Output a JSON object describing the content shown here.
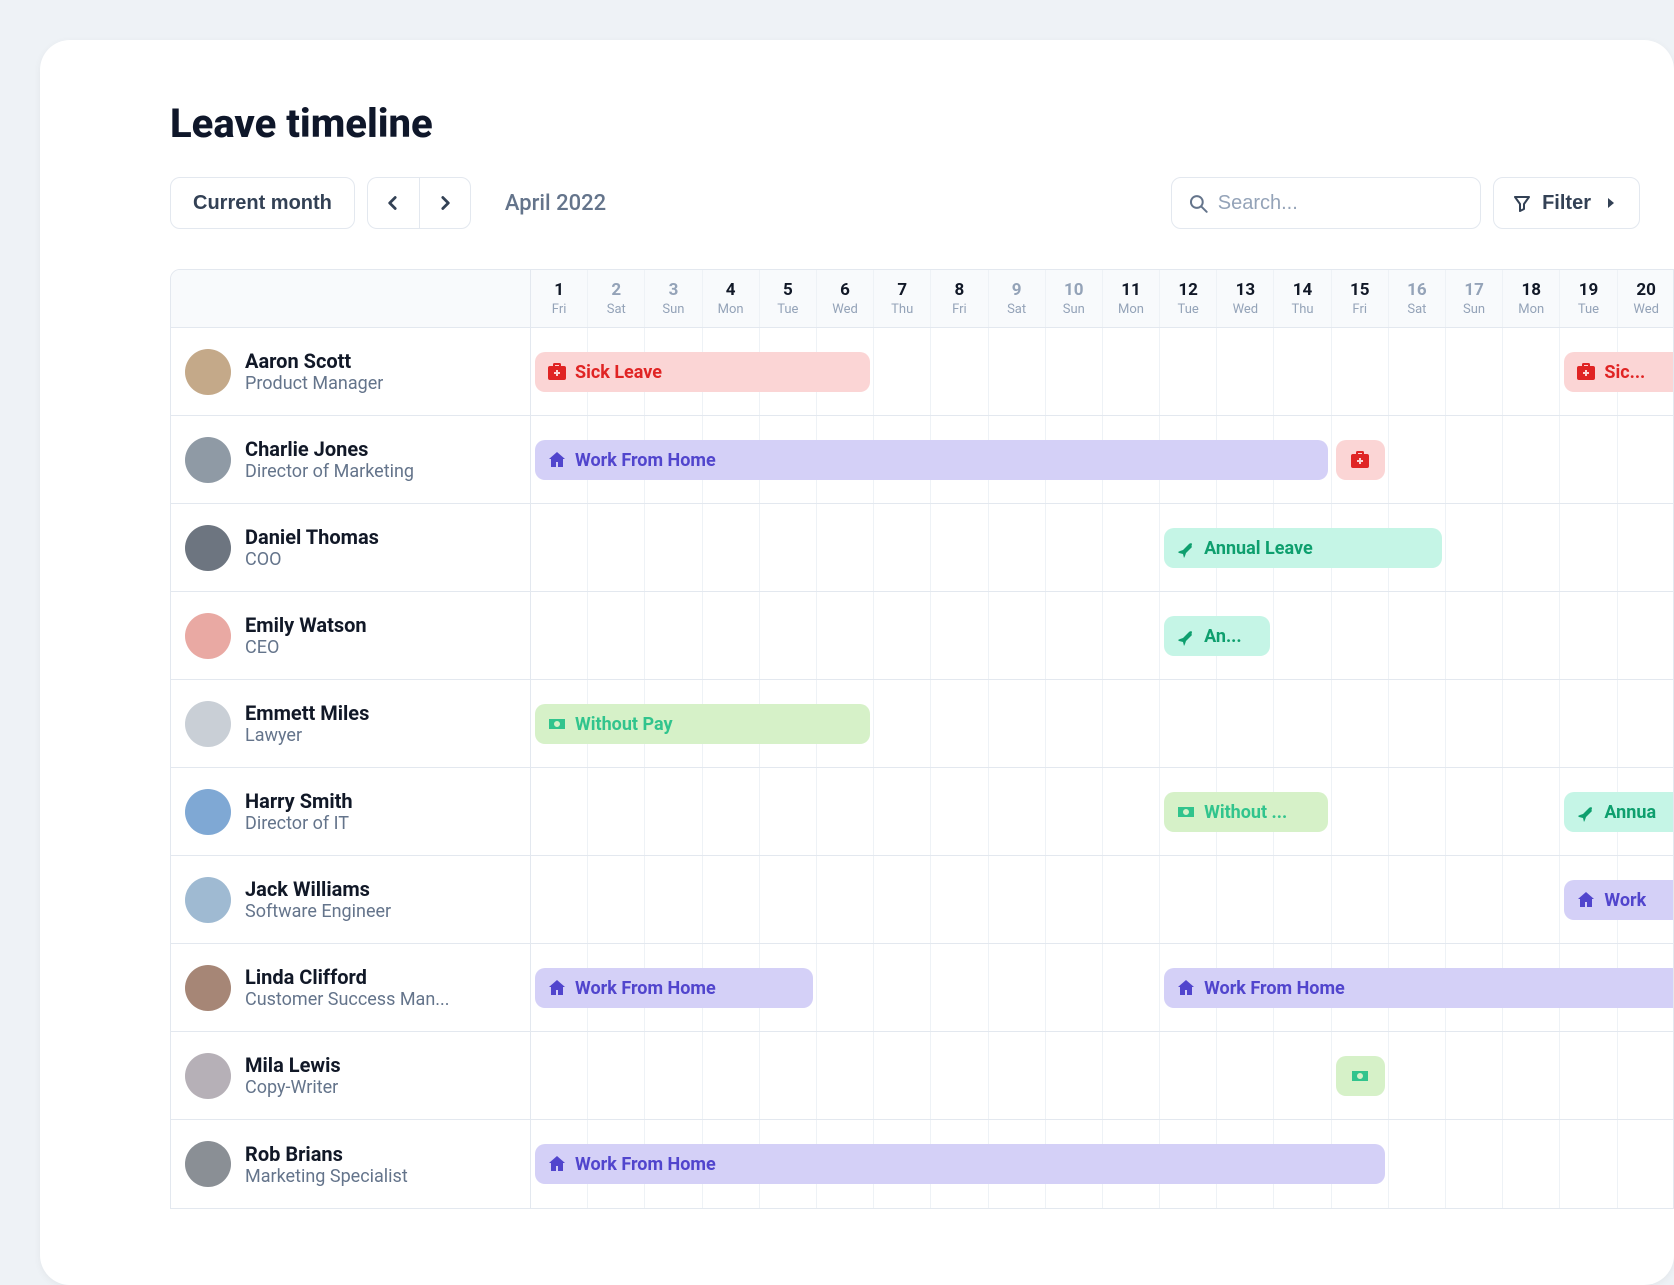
{
  "title": "Leave timeline",
  "toolbar": {
    "range_label": "Current month",
    "month": "April 2022",
    "search_placeholder": "Search...",
    "filter_label": "Filter"
  },
  "days": [
    {
      "num": "1",
      "dow": "Fri",
      "emph": true
    },
    {
      "num": "2",
      "dow": "Sat",
      "emph": false
    },
    {
      "num": "3",
      "dow": "Sun",
      "emph": false
    },
    {
      "num": "4",
      "dow": "Mon",
      "emph": true
    },
    {
      "num": "5",
      "dow": "Tue",
      "emph": true
    },
    {
      "num": "6",
      "dow": "Wed",
      "emph": true
    },
    {
      "num": "7",
      "dow": "Thu",
      "emph": true
    },
    {
      "num": "8",
      "dow": "Fri",
      "emph": true
    },
    {
      "num": "9",
      "dow": "Sat",
      "emph": false
    },
    {
      "num": "10",
      "dow": "Sun",
      "emph": false
    },
    {
      "num": "11",
      "dow": "Mon",
      "emph": true
    },
    {
      "num": "12",
      "dow": "Tue",
      "emph": true
    },
    {
      "num": "13",
      "dow": "Wed",
      "emph": true
    },
    {
      "num": "14",
      "dow": "Thu",
      "emph": true
    },
    {
      "num": "15",
      "dow": "Fri",
      "emph": true
    },
    {
      "num": "16",
      "dow": "Sat",
      "emph": false
    },
    {
      "num": "17",
      "dow": "Sun",
      "emph": false
    },
    {
      "num": "18",
      "dow": "Mon",
      "emph": true
    },
    {
      "num": "19",
      "dow": "Tue",
      "emph": true
    },
    {
      "num": "20",
      "dow": "Wed",
      "emph": true
    }
  ],
  "employees": [
    {
      "name": "Aaron Scott",
      "role": "Product Manager",
      "avatar": "#c4a989",
      "bars": [
        {
          "type": "sick",
          "icon": "medkit",
          "label": "Sick Leave",
          "start": 1,
          "span": 6
        },
        {
          "type": "sick",
          "icon": "medkit",
          "label": "Sic...",
          "start": 19,
          "span": 2,
          "clip_right": true
        }
      ]
    },
    {
      "name": "Charlie Jones",
      "role": "Director of Marketing",
      "avatar": "#8f9aa5",
      "bars": [
        {
          "type": "wfh",
          "icon": "home",
          "label": "Work From Home",
          "start": 1,
          "span": 14
        },
        {
          "type": "sick",
          "icon": "medkit",
          "label": "",
          "start": 15,
          "span": 1,
          "icon_only": true
        }
      ]
    },
    {
      "name": "Daniel Thomas",
      "role": "COO",
      "avatar": "#6d7580",
      "bars": [
        {
          "type": "annual",
          "icon": "plane",
          "label": "Annual Leave",
          "start": 12,
          "span": 5
        }
      ]
    },
    {
      "name": "Emily Watson",
      "role": "CEO",
      "avatar": "#e9a9a3",
      "bars": [
        {
          "type": "annual",
          "icon": "plane",
          "label": "An...",
          "start": 12,
          "span": 2
        }
      ]
    },
    {
      "name": "Emmett Miles",
      "role": "Lawyer",
      "avatar": "#c9cfd6",
      "bars": [
        {
          "type": "nopay",
          "icon": "cash",
          "label": "Without Pay",
          "start": 1,
          "span": 6
        }
      ]
    },
    {
      "name": "Harry Smith",
      "role": "Director of IT",
      "avatar": "#7fa8d4",
      "bars": [
        {
          "type": "nopay",
          "icon": "cash",
          "label": "Without ...",
          "start": 12,
          "span": 3
        },
        {
          "type": "annual",
          "icon": "plane",
          "label": "Annua",
          "start": 19,
          "span": 2,
          "clip_right": true
        }
      ]
    },
    {
      "name": "Jack Williams",
      "role": "Software Engineer",
      "avatar": "#9fbad2",
      "bars": [
        {
          "type": "wfh",
          "icon": "home",
          "label": "Work",
          "start": 19,
          "span": 2,
          "clip_right": true
        }
      ]
    },
    {
      "name": "Linda Clifford",
      "role": "Customer Success Man...",
      "avatar": "#a68676",
      "bars": [
        {
          "type": "wfh",
          "icon": "home",
          "label": "Work From Home",
          "start": 1,
          "span": 5
        },
        {
          "type": "wfh",
          "icon": "home",
          "label": "Work From Home",
          "start": 12,
          "span": 9,
          "clip_right": true
        }
      ]
    },
    {
      "name": "Mila Lewis",
      "role": "Copy-Writer",
      "avatar": "#b6b0b7",
      "bars": [
        {
          "type": "nopay",
          "icon": "cash",
          "label": "",
          "start": 15,
          "span": 1,
          "icon_only": true
        }
      ]
    },
    {
      "name": "Rob Brians",
      "role": "Marketing Specialist",
      "avatar": "#8a8f95",
      "bars": [
        {
          "type": "wfh",
          "icon": "home",
          "label": "Work From Home",
          "start": 1,
          "span": 15
        }
      ]
    }
  ]
}
